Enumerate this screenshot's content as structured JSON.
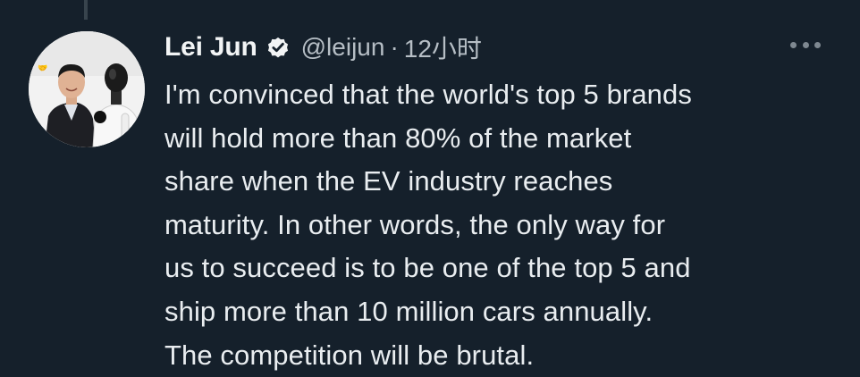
{
  "tweet": {
    "author_name": "Lei Jun",
    "handle": "@leijun",
    "separator": "·",
    "timestamp": "12小时",
    "text_lines": [
      "I'm convinced that the world's top 5 brands",
      "will hold more than 80% of the market",
      "share when the EV industry reaches",
      "maturity. In other words, the only way for",
      "us to succeed is to be one of the top 5 and",
      "ship more than 10 million cars annually.",
      "The competition will be brutal."
    ]
  },
  "icons": {
    "verified": "verified-badge-icon",
    "more": "more-options-icon",
    "avatar": "profile-avatar"
  },
  "colors": {
    "background": "#15202b",
    "text": "#e9edf0",
    "secondary_text": "#b6bec5",
    "thread_line": "#38444d"
  }
}
